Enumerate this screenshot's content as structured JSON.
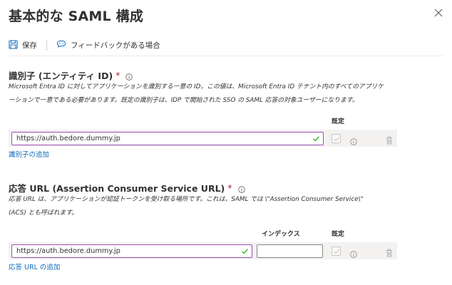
{
  "header": {
    "title": "基本的な SAML 構成"
  },
  "toolbar": {
    "save_label": "保存",
    "feedback_label": "フィードバックがある場合"
  },
  "identifier": {
    "title": "識別子 (エンティティ ID)",
    "required_mark": "*",
    "description_line1": "Microsoft Entra ID に対してアプリケーションを識別する一意の ID。この値は、Microsoft Entra ID テナント内のすべてのアプリケ",
    "description_line2": "ーションで一意である必要があります。既定の識別子は、IDP で開始された SSO の SAML 応答の対象ユーザーになります。",
    "default_header": "既定",
    "value": "https://auth.bedore.dummy.jp",
    "add_link": "識別子の追加"
  },
  "reply_url": {
    "title": "応答 URL (Assertion Consumer Service URL)",
    "required_mark": "*",
    "description_line1": "応答 URL は、アプリケーションが認証トークンを受け取る場所です。これは、SAML では \\\"Assertion Consumer Service\\\"",
    "description_line2": "(ACS) とも呼ばれます。",
    "index_header": "インデックス",
    "default_header": "既定",
    "value": "https://auth.bedore.dummy.jp",
    "index_value": "",
    "add_link": "応答 URL の追加"
  },
  "colors": {
    "accent_border": "#9b4fb0",
    "link": "#0f6cbd",
    "valid_check": "#13a10e",
    "required": "#a4262c"
  }
}
